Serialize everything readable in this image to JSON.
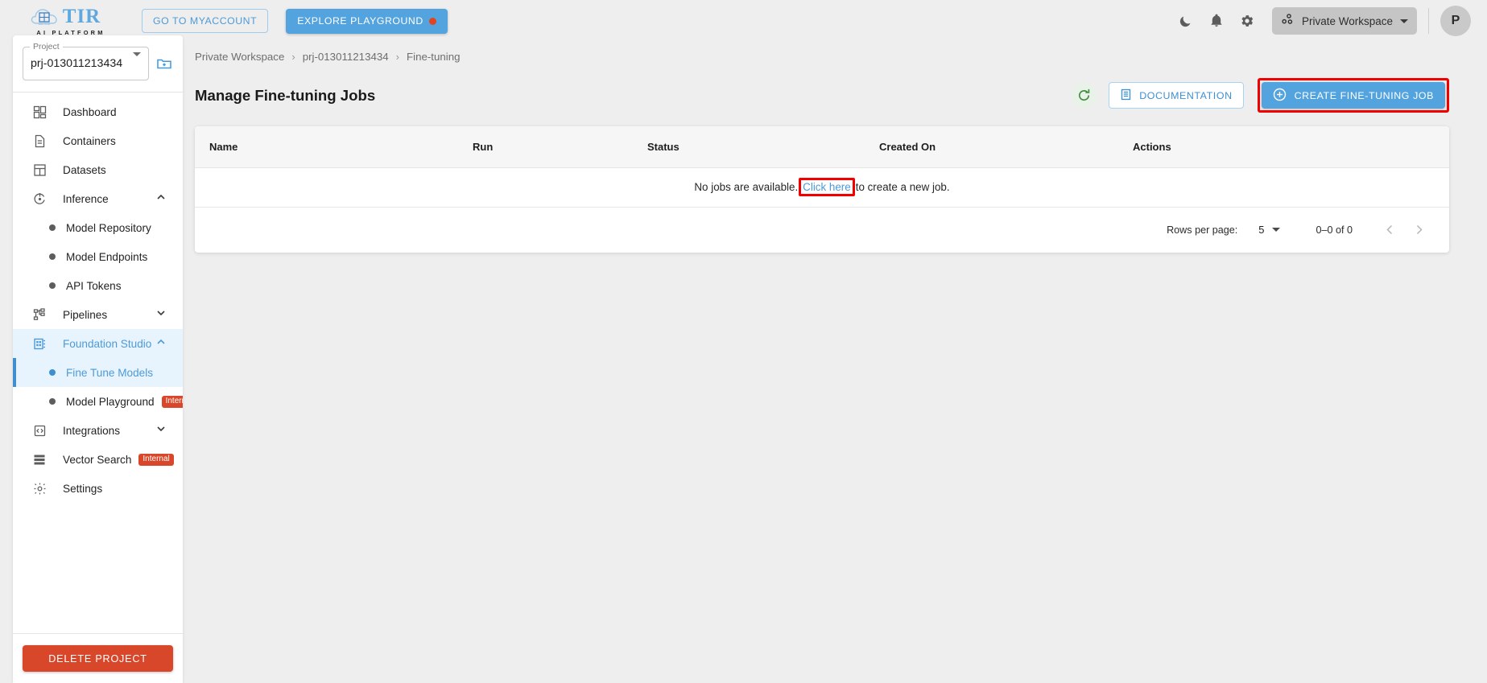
{
  "topbar": {
    "logo_word": "TIR",
    "logo_sub": "AI PLATFORM",
    "myaccount_label": "GO TO MYACCOUNT",
    "playground_label": "EXPLORE PLAYGROUND",
    "icons": {
      "dark_mode": "moon-icon",
      "notifications": "bell-icon",
      "settings": "gear-icon"
    },
    "workspace_label": "Private Workspace",
    "avatar_initial": "P"
  },
  "sidebar": {
    "project_legend": "Project",
    "project_value": "prj-013011213434",
    "new_folder_icon": "new-folder-icon",
    "items": [
      {
        "label": "Dashboard",
        "icon": "dashboard-icon",
        "type": "item"
      },
      {
        "label": "Containers",
        "icon": "document-icon",
        "type": "item"
      },
      {
        "label": "Datasets",
        "icon": "grid-icon",
        "type": "item"
      },
      {
        "label": "Inference",
        "icon": "inference-icon",
        "type": "group",
        "expanded": true
      },
      {
        "label": "Model Repository",
        "type": "sub"
      },
      {
        "label": "Model Endpoints",
        "type": "sub"
      },
      {
        "label": "API Tokens",
        "type": "sub"
      },
      {
        "label": "Pipelines",
        "icon": "pipeline-icon",
        "type": "group",
        "expanded": false
      },
      {
        "label": "Foundation Studio",
        "icon": "studio-icon",
        "type": "group",
        "expanded": true,
        "active": true
      },
      {
        "label": "Fine Tune Models",
        "type": "sub",
        "active": true
      },
      {
        "label": "Model Playground",
        "type": "sub",
        "badge": "Internal"
      },
      {
        "label": "Integrations",
        "icon": "code-icon",
        "type": "group",
        "expanded": false
      },
      {
        "label": "Vector Search",
        "icon": "list-icon",
        "type": "item",
        "badge": "Internal"
      },
      {
        "label": "Settings",
        "icon": "gear-icon",
        "type": "item"
      }
    ],
    "delete_label": "DELETE PROJECT"
  },
  "main": {
    "breadcrumb": [
      "Private Workspace",
      "prj-013011213434",
      "Fine-tuning"
    ],
    "breadcrumb_separator": "›",
    "page_title": "Manage Fine-tuning Jobs",
    "refresh_icon": "refresh-icon",
    "documentation_label": "DOCUMENTATION",
    "create_label": "CREATE FINE-TUNING JOB",
    "table": {
      "columns": [
        "Name",
        "Run",
        "Status",
        "Created On",
        "Actions"
      ],
      "empty_prefix": "No jobs are available.",
      "empty_link": "Click here",
      "empty_suffix": "to create a new job.",
      "rows": []
    },
    "pagination": {
      "rows_per_page_label": "Rows per page:",
      "rows_per_page_value": "5",
      "range_label": "0–0 of 0",
      "prev_icon": "chevron-left-icon",
      "next_icon": "chevron-right-icon"
    }
  },
  "colors": {
    "accent_blue": "#52a3de",
    "link_blue": "#4e9ad6",
    "danger_red": "#d9472b",
    "highlight_red": "#f20000",
    "sidebar_active_bg": "#e8f4fd"
  }
}
